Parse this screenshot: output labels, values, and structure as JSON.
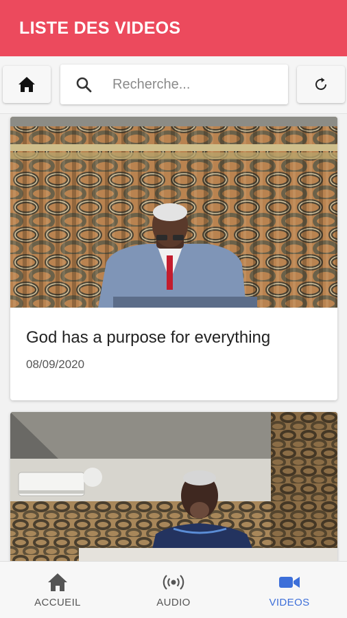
{
  "header": {
    "title": "LISTE DES VIDEOS"
  },
  "toolbar": {
    "home_icon": "home-icon",
    "search_icon": "search-icon",
    "search_placeholder": "Recherche...",
    "search_value": "",
    "refresh_icon": "refresh-icon"
  },
  "videos": [
    {
      "title": "God has a purpose for everything",
      "date": "08/09/2020"
    },
    {
      "title": "",
      "date": ""
    }
  ],
  "nav": {
    "items": [
      {
        "label": "ACCUEIL",
        "icon": "home-icon",
        "active": false
      },
      {
        "label": "AUDIO",
        "icon": "broadcast-icon",
        "active": false
      },
      {
        "label": "VIDEOS",
        "icon": "video-camera-icon",
        "active": true
      }
    ]
  },
  "colors": {
    "header": "#ec4a5d",
    "active_nav": "#3d6fd9",
    "inactive_nav": "#555555"
  }
}
